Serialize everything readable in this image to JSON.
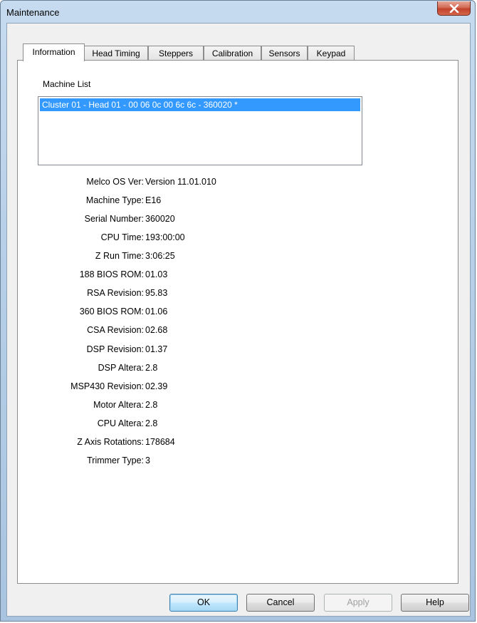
{
  "window": {
    "title": "Maintenance"
  },
  "tabs": [
    {
      "label": "Information"
    },
    {
      "label": "Head Timing"
    },
    {
      "label": "Steppers"
    },
    {
      "label": "Calibration"
    },
    {
      "label": "Sensors"
    },
    {
      "label": "Keypad"
    }
  ],
  "machine_list": {
    "label": "Machine List",
    "items": [
      "Cluster 01 - Head 01 - 00 06 0c 00 6c 6c - 360020 *"
    ]
  },
  "info": [
    {
      "label": "Melco OS Ver:",
      "value": "Version 11.01.010"
    },
    {
      "label": "Machine Type:",
      "value": "E16"
    },
    {
      "label": "Serial Number:",
      "value": "360020"
    },
    {
      "label": "CPU Time:",
      "value": "193:00:00"
    },
    {
      "label": "Z Run Time:",
      "value": "3:06:25"
    },
    {
      "label": "188 BIOS ROM:",
      "value": "01.03"
    },
    {
      "label": "RSA Revision:",
      "value": "95.83"
    },
    {
      "label": "360 BIOS ROM:",
      "value": "01.06"
    },
    {
      "label": "CSA Revision:",
      "value": "02.68"
    },
    {
      "label": "DSP Revision:",
      "value": "01.37"
    },
    {
      "label": "DSP Altera:",
      "value": "2.8"
    },
    {
      "label": "MSP430 Revision:",
      "value": "02.39"
    },
    {
      "label": "Motor Altera:",
      "value": "2.8"
    },
    {
      "label": "CPU Altera:",
      "value": "2.8"
    },
    {
      "label": "Z Axis Rotations:",
      "value": "178684"
    },
    {
      "label": "Trimmer Type:",
      "value": "3"
    }
  ],
  "buttons": {
    "ok": "OK",
    "cancel": "Cancel",
    "apply": "Apply",
    "help": "Help"
  },
  "icons": {
    "close": "close-icon"
  }
}
